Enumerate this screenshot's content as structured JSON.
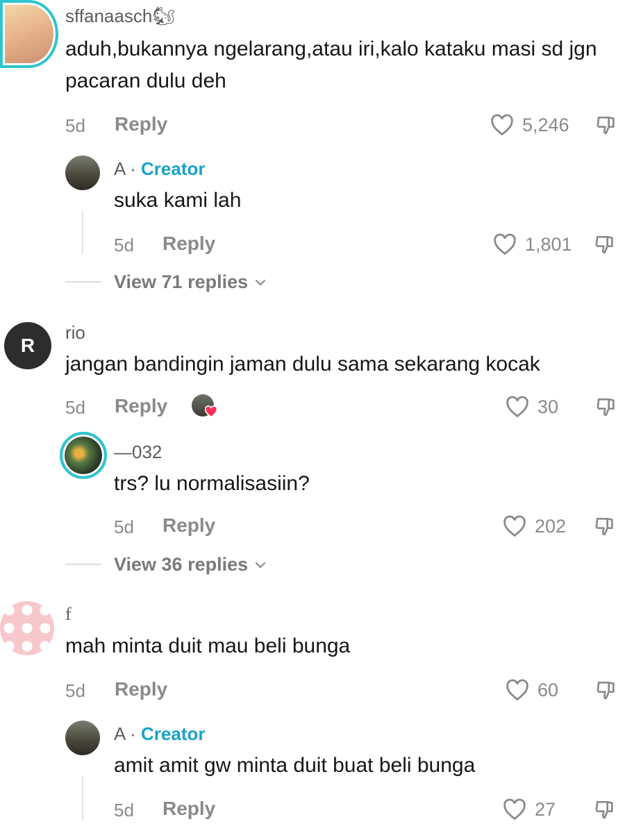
{
  "comments": [
    {
      "username": "sffanaasch🐿",
      "text": "aduh,bukannya ngelarang,atau iri,kalo kataku masi sd jgn pacaran dulu deh",
      "age": "5d",
      "reply_label": "Reply",
      "likes": "5,246",
      "replies": [
        {
          "username": "A",
          "badge": "Creator",
          "text": "suka kami lah",
          "age": "5d",
          "reply_label": "Reply",
          "likes": "1,801"
        }
      ],
      "view_replies": "View 71 replies"
    },
    {
      "username": "rio",
      "avatar_letter": "R",
      "text": "jangan bandingin jaman dulu sama sekarang kocak",
      "age": "5d",
      "reply_label": "Reply",
      "likes": "30",
      "replies": [
        {
          "username": "—032",
          "text": "trs? lu normalisasiin?",
          "age": "5d",
          "reply_label": "Reply",
          "likes": "202"
        }
      ],
      "view_replies": "View 36 replies"
    },
    {
      "username": "f",
      "text": "mah minta duit mau beli bunga",
      "age": "5d",
      "reply_label": "Reply",
      "likes": "60",
      "replies": [
        {
          "username": "A",
          "badge": "Creator",
          "text": "amit amit gw minta duit buat beli bunga",
          "age": "5d",
          "reply_label": "Reply",
          "likes": "27"
        }
      ]
    }
  ],
  "colors": {
    "creator_badge": "#1aa2c8",
    "story_ring": "#2ec5cf",
    "muted": "#8a8a8a",
    "text": "#161616",
    "liked_heart": "#ff2d55"
  },
  "icons": [
    "heart-outline-icon",
    "thumbs-down-icon",
    "chevron-down-icon",
    "liked-by-creator-icon"
  ]
}
